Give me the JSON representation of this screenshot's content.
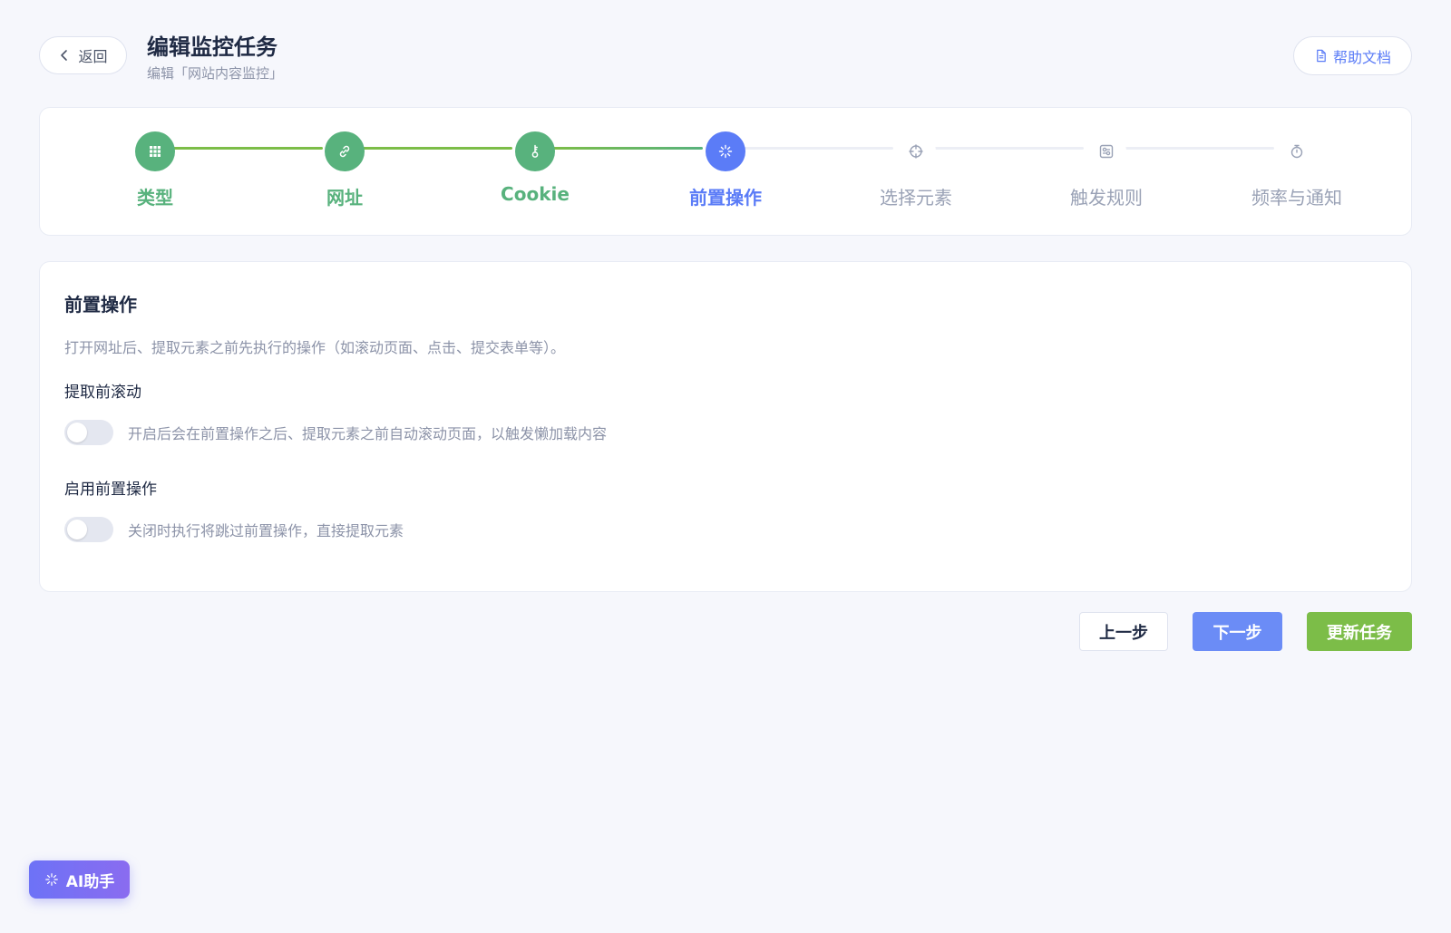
{
  "header": {
    "back_label": "返回",
    "title": "编辑监控任务",
    "subtitle": "编辑「网站内容监控」",
    "help_label": "帮助文档"
  },
  "steps": [
    {
      "label": "类型",
      "status": "done",
      "icon": "grid-icon"
    },
    {
      "label": "网址",
      "status": "done",
      "icon": "link-icon"
    },
    {
      "label": "Cookie",
      "status": "done",
      "icon": "key-icon"
    },
    {
      "label": "前置操作",
      "status": "active",
      "icon": "spinner-icon"
    },
    {
      "label": "选择元素",
      "status": "todo",
      "icon": "crosshair-icon"
    },
    {
      "label": "触发规则",
      "status": "todo",
      "icon": "sliders-icon"
    },
    {
      "label": "频率与通知",
      "status": "todo",
      "icon": "stopwatch-icon"
    }
  ],
  "section": {
    "title": "前置操作",
    "description": "打开网址后、提取元素之前先执行的操作（如滚动页面、点击、提交表单等）。",
    "fields": [
      {
        "label": "提取前滚动",
        "enabled": false,
        "hint": "开启后会在前置操作之后、提取元素之前自动滚动页面，以触发懒加载内容"
      },
      {
        "label": "启用前置操作",
        "enabled": false,
        "hint": "关闭时执行将跳过前置操作，直接提取元素"
      }
    ]
  },
  "footer": {
    "prev_label": "上一步",
    "next_label": "下一步",
    "update_label": "更新任务"
  },
  "ai": {
    "label": "AI助手"
  },
  "colors": {
    "done": "#58b27d",
    "active": "#5b7cf7",
    "todo": "#9aa2b6",
    "update": "#7cbd48"
  }
}
